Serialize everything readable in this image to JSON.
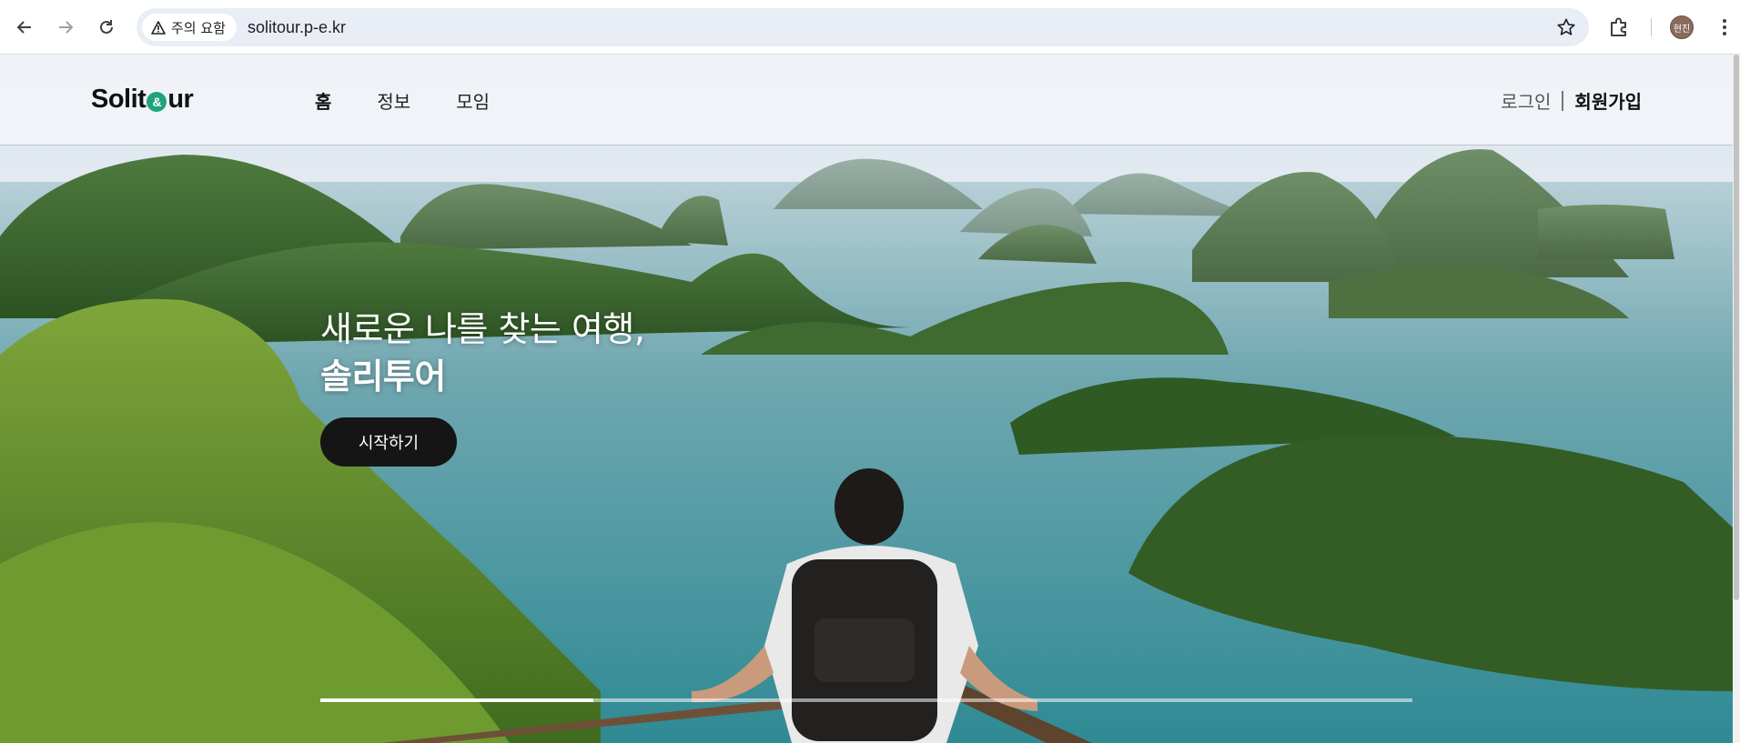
{
  "browser": {
    "back_icon": "arrow-left-icon",
    "forward_icon": "arrow-right-icon",
    "reload_icon": "reload-icon",
    "security_label": "주의 요함",
    "url": "solitour.p-e.kr",
    "profile_initials": "현진"
  },
  "site": {
    "logo_left": "Solit",
    "logo_right": "ur",
    "nav": [
      {
        "label": "홈",
        "active": true
      },
      {
        "label": "정보",
        "active": false
      },
      {
        "label": "모임",
        "active": false
      }
    ],
    "login_label": "로그인",
    "signup_label": "회원가입"
  },
  "hero": {
    "line1": "새로운 나를 찾는 여행,",
    "line2": "솔리투어",
    "cta_label": "시작하기",
    "slide_progress": 0.25
  },
  "colors": {
    "brand_green": "#1fa37a",
    "cta_bg": "#151515"
  }
}
